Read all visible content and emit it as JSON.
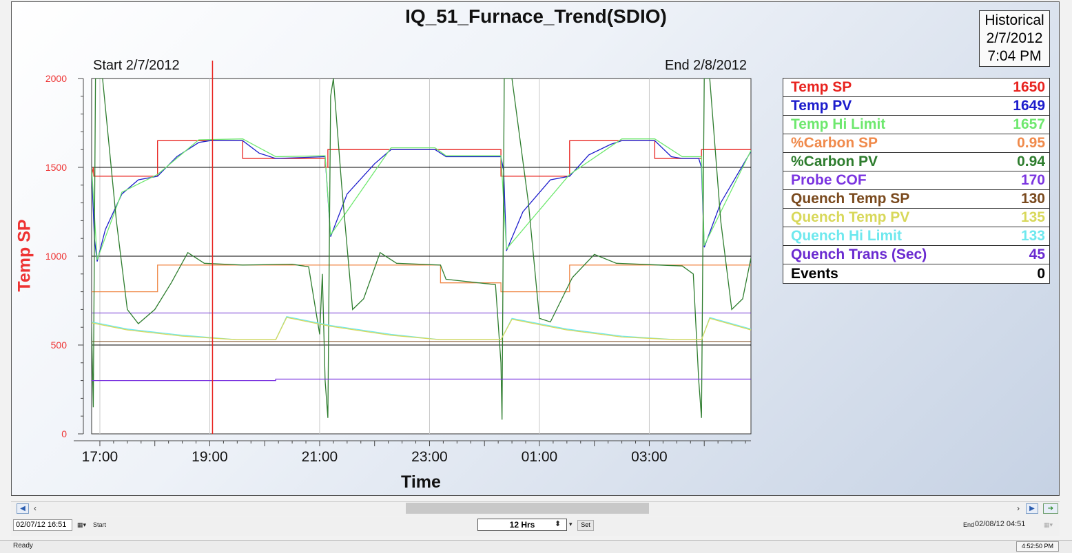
{
  "title": "IQ_51_Furnace_Trend(SDIO)",
  "mode_box": {
    "line1": "Historical",
    "line2": "2/7/2012",
    "line3": "7:04 PM"
  },
  "start_label": "Start 2/7/2012",
  "end_label": "End 2/8/2012",
  "legend": [
    {
      "name": "Temp SP",
      "value": "1650",
      "color": "#e8231f"
    },
    {
      "name": "Temp PV",
      "value": "1649",
      "color": "#1c1ccc"
    },
    {
      "name": "Temp Hi Limit",
      "value": "1657",
      "color": "#6ee86e"
    },
    {
      "name": "%Carbon SP",
      "value": "0.95",
      "color": "#f08a4b"
    },
    {
      "name": "%Carbon PV",
      "value": "0.94",
      "color": "#2e7d2e"
    },
    {
      "name": "Probe COF",
      "value": "170",
      "color": "#7b35e0"
    },
    {
      "name": "Quench Temp SP",
      "value": "130",
      "color": "#7a4a1e"
    },
    {
      "name": "Quench Temp PV",
      "value": "135",
      "color": "#d8d85a"
    },
    {
      "name": "Quench Hi Limit",
      "value": "133",
      "color": "#6ee8ee"
    },
    {
      "name": "Quench Trans (Sec)",
      "value": "45",
      "color": "#6a2ad0"
    },
    {
      "name": "Events",
      "value": "0",
      "color": "#000000"
    }
  ],
  "toolbar": {
    "start_datetime": "02/07/12  16:51",
    "start_label": "Start",
    "duration": "12 Hrs",
    "set_label": "Set",
    "end_label": "End",
    "end_datetime": "02/08/12  04:51",
    "status": "Ready",
    "clock": "4:52:50 PM"
  },
  "chart_data": {
    "type": "line",
    "title": "IQ_51_Furnace_Trend(SDIO)",
    "xlabel": "Time",
    "ylabel": "Temp SP",
    "x_range_hours": [
      16.85,
      28.85
    ],
    "x_ticks": [
      "17:00",
      "19:00",
      "21:00",
      "23:00",
      "01:00",
      "03:00"
    ],
    "x_tick_hours": [
      17,
      19,
      21,
      23,
      25,
      27
    ],
    "ylim": [
      0,
      2000
    ],
    "y_ticks": [
      0,
      500,
      1000,
      1500,
      2000
    ],
    "cursor_hour": 19.05,
    "reference_lines": [
      {
        "y": 1500,
        "color": "#000000"
      },
      {
        "y": 1000,
        "color": "#000000"
      },
      {
        "y": 680,
        "color": "#6a2ad0"
      },
      {
        "y": 520,
        "color": "#7a4a1e"
      },
      {
        "y": 500,
        "color": "#000000"
      }
    ],
    "series": [
      {
        "name": "Temp SP",
        "color": "#e8231f",
        "points": [
          [
            16.85,
            1450
          ],
          [
            16.88,
            1500
          ],
          [
            16.89,
            1450
          ],
          [
            18.05,
            1450
          ],
          [
            18.05,
            1650
          ],
          [
            19.6,
            1650
          ],
          [
            19.6,
            1550
          ],
          [
            21.1,
            1550
          ],
          [
            21.1,
            1500
          ],
          [
            21.15,
            1500
          ],
          [
            21.15,
            1600
          ],
          [
            24.3,
            1600
          ],
          [
            24.3,
            1450
          ],
          [
            25.55,
            1450
          ],
          [
            25.55,
            1650
          ],
          [
            27.1,
            1650
          ],
          [
            27.1,
            1550
          ],
          [
            27.95,
            1550
          ],
          [
            27.95,
            1600
          ],
          [
            28.85,
            1600
          ]
        ]
      },
      {
        "name": "%Carbon SP",
        "color": "#f08a4b",
        "points": [
          [
            16.85,
            800
          ],
          [
            18.05,
            800
          ],
          [
            18.05,
            950
          ],
          [
            23.2,
            950
          ],
          [
            23.2,
            850
          ],
          [
            24.3,
            850
          ],
          [
            24.3,
            800
          ],
          [
            25.55,
            800
          ],
          [
            25.55,
            950
          ],
          [
            28.85,
            950
          ]
        ]
      },
      {
        "name": "Temp PV",
        "color": "#1c1ccc",
        "points": [
          [
            16.85,
            1500
          ],
          [
            16.9,
            1100
          ],
          [
            16.95,
            970
          ],
          [
            17.1,
            1150
          ],
          [
            17.4,
            1350
          ],
          [
            17.7,
            1430
          ],
          [
            18.05,
            1450
          ],
          [
            18.4,
            1560
          ],
          [
            18.8,
            1640
          ],
          [
            19.0,
            1650
          ],
          [
            19.6,
            1650
          ],
          [
            19.9,
            1580
          ],
          [
            20.2,
            1550
          ],
          [
            21.1,
            1560
          ],
          [
            21.2,
            1110
          ],
          [
            21.5,
            1350
          ],
          [
            22.0,
            1520
          ],
          [
            22.3,
            1600
          ],
          [
            23.1,
            1600
          ],
          [
            23.3,
            1560
          ],
          [
            24.3,
            1560
          ],
          [
            24.35,
            1480
          ],
          [
            24.4,
            1030
          ],
          [
            24.7,
            1250
          ],
          [
            25.2,
            1430
          ],
          [
            25.55,
            1450
          ],
          [
            25.9,
            1570
          ],
          [
            26.3,
            1630
          ],
          [
            26.5,
            1650
          ],
          [
            27.1,
            1650
          ],
          [
            27.4,
            1560
          ],
          [
            27.6,
            1550
          ],
          [
            27.9,
            1550
          ],
          [
            27.95,
            1500
          ],
          [
            28.0,
            1050
          ],
          [
            28.3,
            1300
          ],
          [
            28.85,
            1590
          ]
        ]
      },
      {
        "name": "Temp Hi Limit",
        "color": "#6ee86e",
        "points": [
          [
            16.85,
            1500
          ],
          [
            16.95,
            980
          ],
          [
            17.4,
            1360
          ],
          [
            18.05,
            1460
          ],
          [
            18.8,
            1655
          ],
          [
            19.6,
            1660
          ],
          [
            20.2,
            1560
          ],
          [
            21.1,
            1565
          ],
          [
            21.2,
            1120
          ],
          [
            22.3,
            1610
          ],
          [
            23.1,
            1610
          ],
          [
            23.3,
            1565
          ],
          [
            24.3,
            1565
          ],
          [
            24.4,
            1040
          ],
          [
            25.55,
            1460
          ],
          [
            26.5,
            1660
          ],
          [
            27.1,
            1660
          ],
          [
            27.6,
            1560
          ],
          [
            27.95,
            1560
          ],
          [
            28.0,
            1060
          ],
          [
            28.85,
            1595
          ]
        ]
      },
      {
        "name": "%Carbon PV",
        "color": "#2e7d2e",
        "points": [
          [
            16.85,
            600
          ],
          [
            16.88,
            150
          ],
          [
            16.92,
            2000
          ],
          [
            17.05,
            2000
          ],
          [
            17.3,
            1200
          ],
          [
            17.5,
            700
          ],
          [
            17.7,
            620
          ],
          [
            18.0,
            700
          ],
          [
            18.3,
            850
          ],
          [
            18.6,
            1020
          ],
          [
            18.9,
            960
          ],
          [
            19.6,
            950
          ],
          [
            20.5,
            955
          ],
          [
            20.8,
            940
          ],
          [
            21.0,
            560
          ],
          [
            21.05,
            900
          ],
          [
            21.1,
            300
          ],
          [
            21.15,
            90
          ],
          [
            21.2,
            1900
          ],
          [
            21.25,
            2000
          ],
          [
            21.4,
            1400
          ],
          [
            21.6,
            700
          ],
          [
            21.8,
            760
          ],
          [
            22.1,
            1020
          ],
          [
            22.4,
            960
          ],
          [
            23.2,
            950
          ],
          [
            23.3,
            870
          ],
          [
            24.2,
            840
          ],
          [
            24.3,
            400
          ],
          [
            24.32,
            80
          ],
          [
            24.36,
            2000
          ],
          [
            24.5,
            2000
          ],
          [
            24.8,
            1300
          ],
          [
            25.0,
            650
          ],
          [
            25.2,
            630
          ],
          [
            25.6,
            880
          ],
          [
            26.0,
            1010
          ],
          [
            26.4,
            960
          ],
          [
            27.6,
            945
          ],
          [
            27.8,
            900
          ],
          [
            27.9,
            300
          ],
          [
            27.95,
            90
          ],
          [
            28.0,
            2000
          ],
          [
            28.1,
            2000
          ],
          [
            28.3,
            1200
          ],
          [
            28.5,
            700
          ],
          [
            28.7,
            760
          ],
          [
            28.85,
            990
          ]
        ]
      },
      {
        "name": "Quench Hi Limit",
        "color": "#6ee8ee",
        "points": [
          [
            16.85,
            630
          ],
          [
            17.5,
            590
          ],
          [
            18.5,
            555
          ],
          [
            19.5,
            530
          ],
          [
            20.2,
            530
          ],
          [
            20.4,
            660
          ],
          [
            21.2,
            610
          ],
          [
            22.3,
            560
          ],
          [
            23.2,
            530
          ],
          [
            24.3,
            530
          ],
          [
            24.5,
            650
          ],
          [
            25.5,
            590
          ],
          [
            26.5,
            550
          ],
          [
            27.5,
            530
          ],
          [
            27.95,
            530
          ],
          [
            28.1,
            655
          ],
          [
            28.85,
            590
          ]
        ]
      },
      {
        "name": "Quench Temp PV",
        "color": "#d8d85a",
        "points": [
          [
            16.85,
            625
          ],
          [
            17.5,
            585
          ],
          [
            18.5,
            550
          ],
          [
            19.5,
            530
          ],
          [
            20.2,
            530
          ],
          [
            20.4,
            655
          ],
          [
            21.2,
            605
          ],
          [
            22.3,
            555
          ],
          [
            23.2,
            530
          ],
          [
            24.3,
            530
          ],
          [
            24.5,
            645
          ],
          [
            25.5,
            585
          ],
          [
            26.5,
            545
          ],
          [
            27.5,
            530
          ],
          [
            27.95,
            530
          ],
          [
            28.1,
            650
          ],
          [
            28.85,
            585
          ]
        ]
      },
      {
        "name": "Probe COF",
        "color": "#7b35e0",
        "points": [
          [
            16.85,
            300
          ],
          [
            20.2,
            300
          ],
          [
            20.2,
            308
          ],
          [
            28.85,
            308
          ]
        ]
      }
    ]
  }
}
